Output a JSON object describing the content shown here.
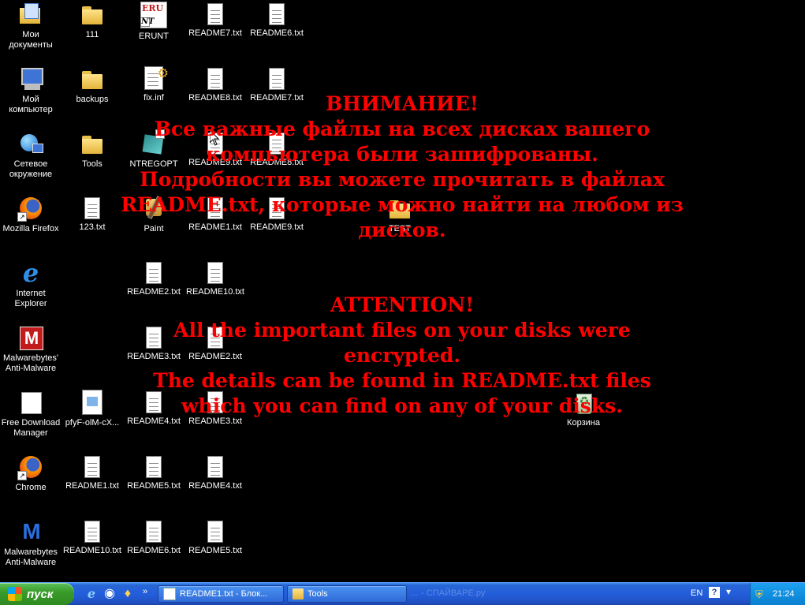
{
  "desktop": {
    "col1": [
      {
        "label": "Мои\nдокументы",
        "icon": "my-documents-icon"
      },
      {
        "label": "Мой\nкомпьютер",
        "icon": "my-computer-icon"
      },
      {
        "label": "Сетевое\nокружение",
        "icon": "network-places-icon"
      },
      {
        "label": "Mozilla Firefox",
        "icon": "firefox-icon"
      },
      {
        "label": "Internet\nExplorer",
        "icon": "internet-explorer-icon"
      },
      {
        "label": "Malwarebytes'\nAnti-Malware",
        "icon": "malwarebytes-red-icon"
      },
      {
        "label": "Free Download\nManager",
        "icon": "free-download-manager-icon"
      },
      {
        "label": "Chrome",
        "icon": "chrome-icon"
      },
      {
        "label": "Malwarebytes\nAnti-Malware",
        "icon": "malwarebytes-blue-icon"
      }
    ],
    "col2": [
      {
        "label": "111",
        "icon": "folder-icon"
      },
      {
        "label": "backups",
        "icon": "folder-icon"
      },
      {
        "label": "Tools",
        "icon": "folder-icon"
      },
      {
        "label": "123.txt",
        "icon": "text-file-icon"
      },
      {
        "label": "pfyF-olM-cX...",
        "icon": "image-file-icon"
      },
      {
        "label": "README1.txt",
        "icon": "text-file-icon"
      },
      {
        "label": "README10.txt",
        "icon": "text-file-icon"
      }
    ],
    "col3": [
      {
        "label": "ERUNT",
        "icon": "erunt-icon"
      },
      {
        "label": "fix.inf",
        "icon": "inf-file-icon"
      },
      {
        "label": "NTREGOPT",
        "icon": "ntregopt-icon"
      },
      {
        "label": "Paint",
        "icon": "paint-icon"
      },
      {
        "label": "README2.txt",
        "icon": "text-file-icon"
      },
      {
        "label": "README3.txt",
        "icon": "text-file-icon"
      },
      {
        "label": "README4.txt",
        "icon": "text-file-icon"
      },
      {
        "label": "README5.txt",
        "icon": "text-file-icon"
      },
      {
        "label": "README6.txt",
        "icon": "text-file-icon"
      }
    ],
    "col4": [
      {
        "label": "README7.txt",
        "icon": "text-file-icon"
      },
      {
        "label": "README8.txt",
        "icon": "text-file-icon"
      },
      {
        "label": "README9.txt",
        "icon": "text-file-icon"
      },
      {
        "label": "README1.txt",
        "icon": "text-file-icon"
      },
      {
        "label": "README10.txt",
        "icon": "text-file-icon"
      },
      {
        "label": "README2.txt",
        "icon": "text-file-icon"
      },
      {
        "label": "README3.txt",
        "icon": "text-file-icon"
      },
      {
        "label": "README4.txt",
        "icon": "text-file-icon"
      },
      {
        "label": "README5.txt",
        "icon": "text-file-icon"
      }
    ],
    "col5": [
      {
        "label": "README6.txt",
        "icon": "text-file-icon"
      },
      {
        "label": "README7.txt",
        "icon": "text-file-icon"
      },
      {
        "label": "README8.txt",
        "icon": "text-file-icon"
      },
      {
        "label": "README9.txt",
        "icon": "text-file-icon"
      }
    ],
    "test_folder": {
      "label": "TEST",
      "icon": "folder-icon"
    },
    "recycle_bin": {
      "label": "Корзина",
      "icon": "recycle-bin-icon"
    }
  },
  "ransom": {
    "color": "#ff0000",
    "ru_lines": [
      "ВНИМАНИЕ!",
      "Все важные файлы на всех дисках вашего",
      "компьютера были зашифрованы.",
      "Подробности вы можете прочитать в файлах",
      "README.txt, которые можно найти на любом из",
      "дисков."
    ],
    "en_lines": [
      "ATTENTION!",
      "All the important files on your disks were",
      "encrypted.",
      "The details can be found in README.txt files",
      "which you can find on any of your disks."
    ]
  },
  "taskbar": {
    "start_label": "пуск",
    "tasks": [
      {
        "label": "README1.txt - Блок...",
        "icon": "notepad-icon"
      },
      {
        "label": "Tools",
        "icon": "folder-icon"
      }
    ],
    "watermark": "… - СПАЙВАРЕ.ру",
    "language": "EN",
    "help": "?",
    "clock": "21:24"
  }
}
